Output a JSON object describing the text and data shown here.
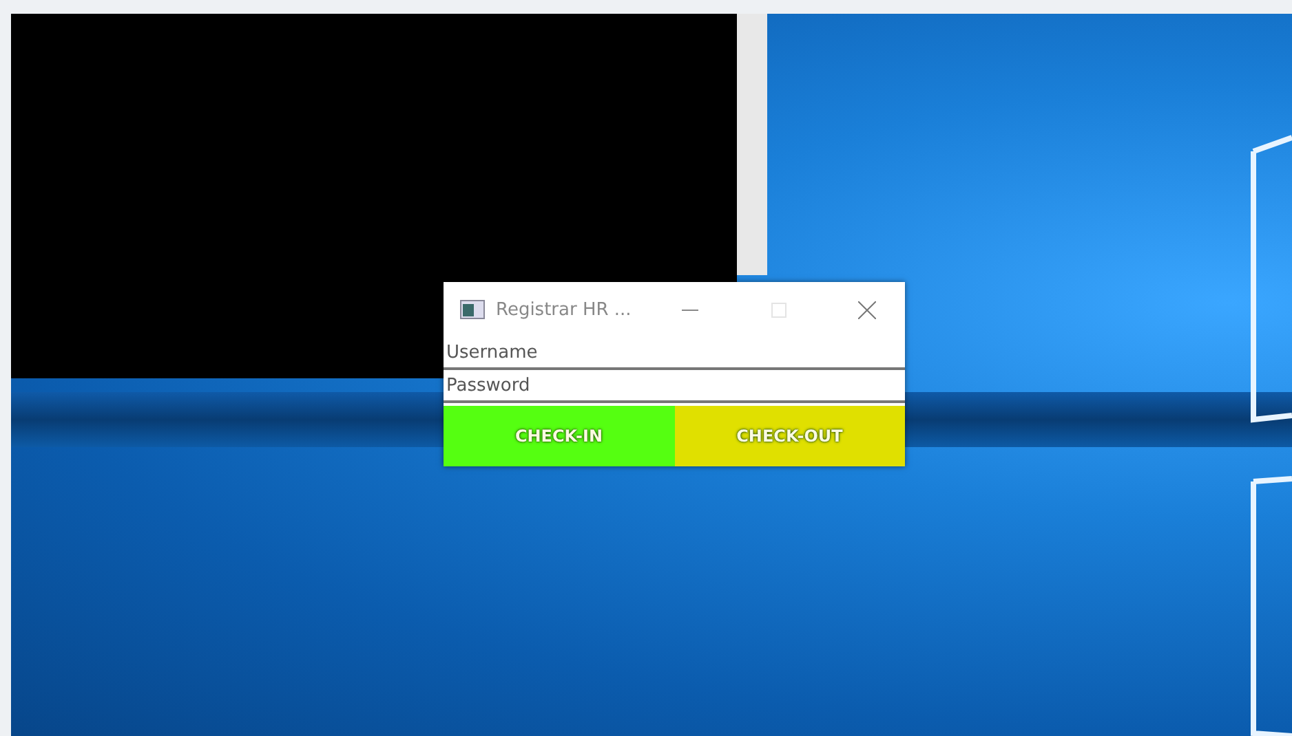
{
  "dialog": {
    "title": "Registrar HR ...",
    "maximize_disabled": true,
    "username": {
      "placeholder": "Username"
    },
    "password": {
      "placeholder": "Password"
    },
    "buttons": [
      {
        "label": "CHECK-IN",
        "color": "#55ff11"
      },
      {
        "label": "CHECK-OUT",
        "color": "#e0e000"
      }
    ]
  }
}
